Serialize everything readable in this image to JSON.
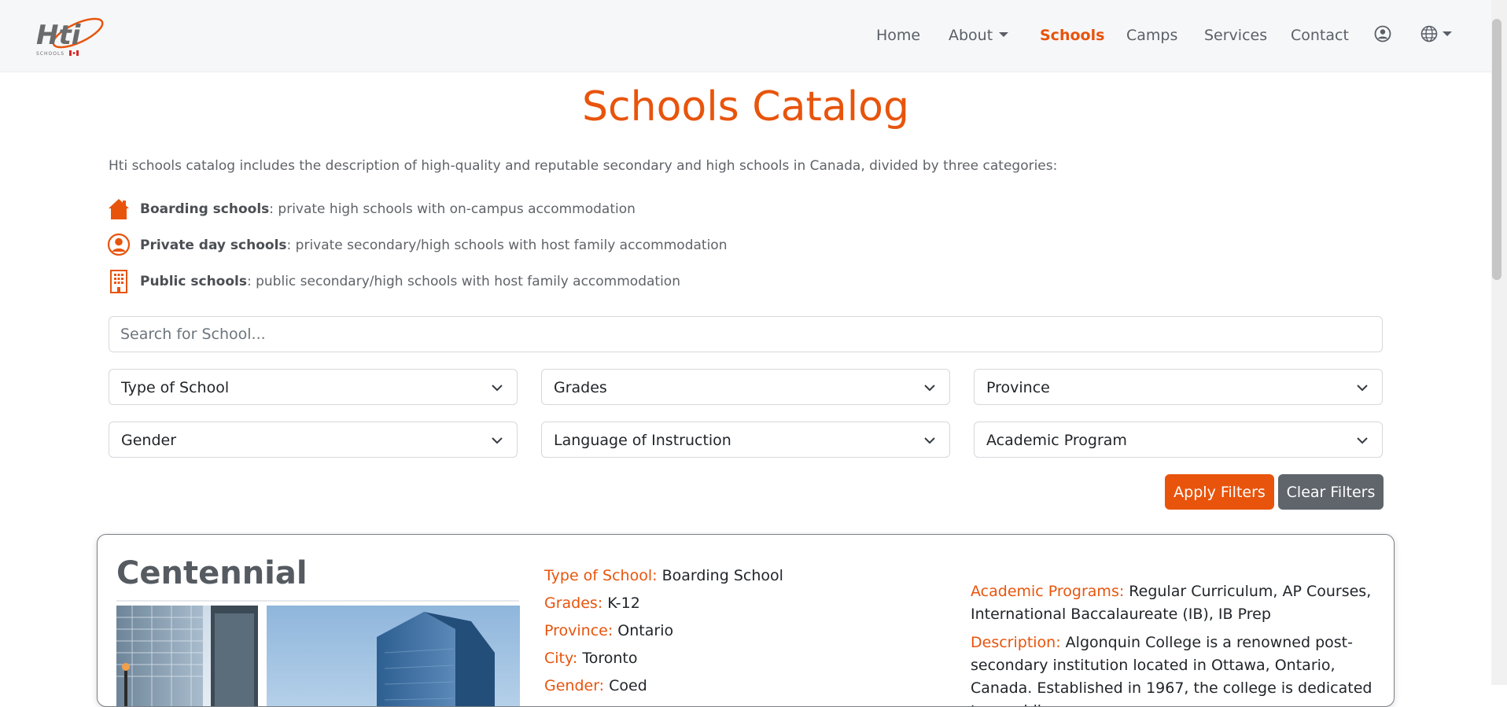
{
  "brand": {
    "logo_text": "Hti",
    "logo_sub": "SCHOOLS"
  },
  "nav": {
    "home": "Home",
    "about": "About",
    "schools": "Schools",
    "camps": "Camps",
    "services": "Services",
    "contact": "Contact"
  },
  "page": {
    "title": "Schools Catalog",
    "intro": "Hti schools catalog includes the description of high-quality and reputable secondary and high schools in Canada, divided by three categories:",
    "categories": [
      {
        "icon": "house-icon",
        "name": "Boarding schools",
        "desc": ": private high schools with on-campus accommodation"
      },
      {
        "icon": "person-circle-icon",
        "name": "Private day schools",
        "desc": ": private secondary/high schools with host family accommodation"
      },
      {
        "icon": "building-icon",
        "name": "Public schools",
        "desc": ": public secondary/high schools with host family accommodation"
      }
    ]
  },
  "search": {
    "placeholder": "Search for School..."
  },
  "filters": {
    "type": "Type of School",
    "grades": "Grades",
    "province": "Province",
    "gender": "Gender",
    "language": "Language of Instruction",
    "program": "Academic Program"
  },
  "buttons": {
    "apply": "Apply Filters",
    "clear": "Clear Filters"
  },
  "school": {
    "name": "Centennial",
    "type_label": "Type of School:",
    "type": "Boarding School",
    "grades_label": "Grades:",
    "grades": "K-12",
    "province_label": "Province:",
    "province": "Ontario",
    "city_label": "City:",
    "city": "Toronto",
    "gender_label": "Gender:",
    "gender": "Coed",
    "programs_label": "Academic Programs:",
    "programs": "Regular Curriculum, AP Courses, International Baccalaureate (IB), IB Prep",
    "description_label": "Description:",
    "description": "Algonquin College is a renowned post-secondary institution located in Ottawa, Ontario, Canada. Established in 1967, the college is dedicated to providing"
  },
  "colors": {
    "accent": "#e8540c",
    "secondary_button": "#5f656b",
    "navbar_bg": "#f6f7f9"
  }
}
